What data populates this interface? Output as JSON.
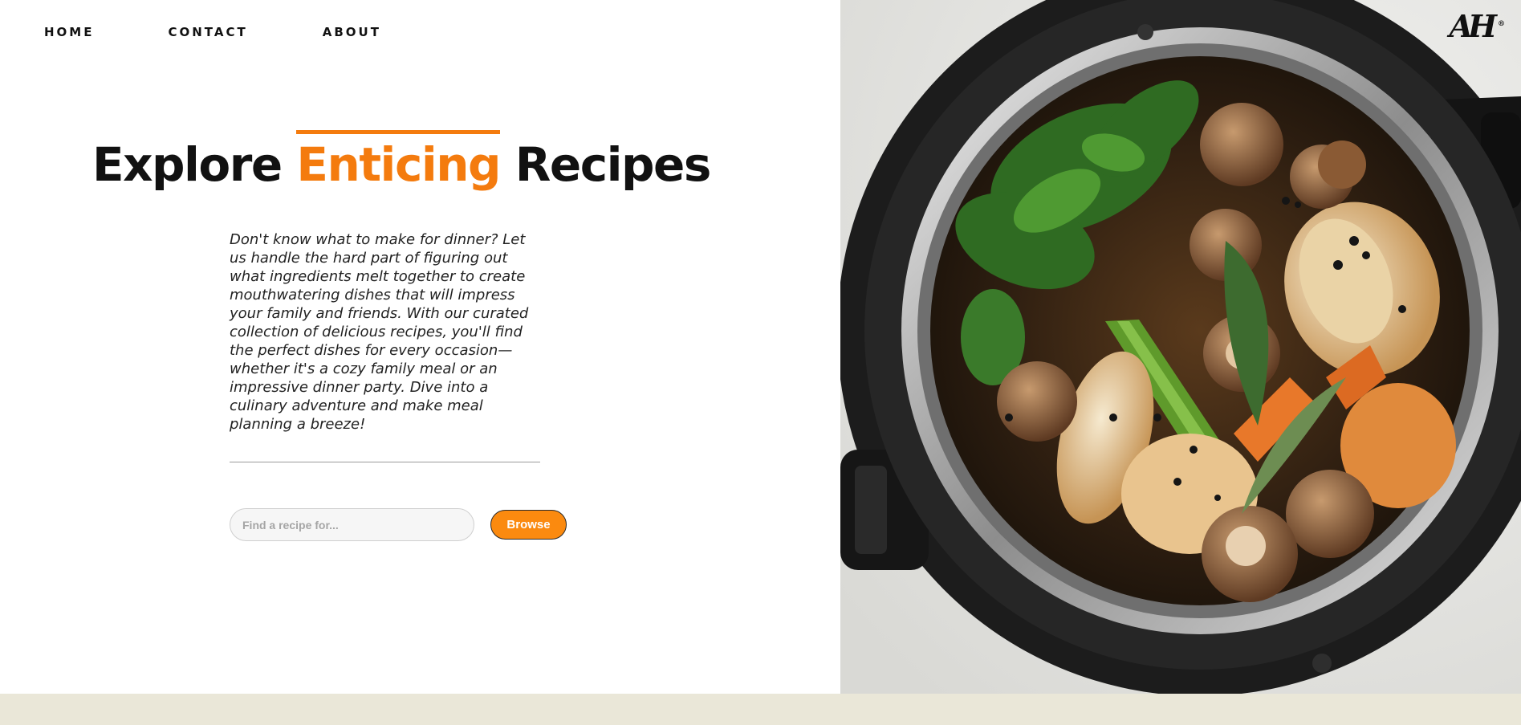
{
  "nav": {
    "home": "HOME",
    "contact": "CONTACT",
    "about": "ABOUT"
  },
  "hero": {
    "title_pre": "Explore",
    "title_accent": "Enticing",
    "title_post": "Recipes",
    "description": "Don't know what to make for dinner? Let us handle the hard part of figuring out what ingredients melt together to create mouthwatering dishes that will impress your family and friends. With our curated collection of delicious recipes, you'll find the perfect dishes for every occasion—whether it's a cozy family meal or an impressive dinner party. Dive into a culinary adventure and make meal planning a breeze!"
  },
  "search": {
    "placeholder": "Find a recipe for...",
    "value": ""
  },
  "browse_label": "Browse",
  "logo": {
    "text": "AH",
    "mark": "®"
  },
  "colors": {
    "accent": "#f47b0e",
    "button": "#fb8a0f",
    "footer": "#eae7d8",
    "text": "#111111"
  },
  "image": {
    "subject": "pressure cooker pot with broth, mushrooms, onions, carrots, celery, parsley and bay leaves"
  }
}
